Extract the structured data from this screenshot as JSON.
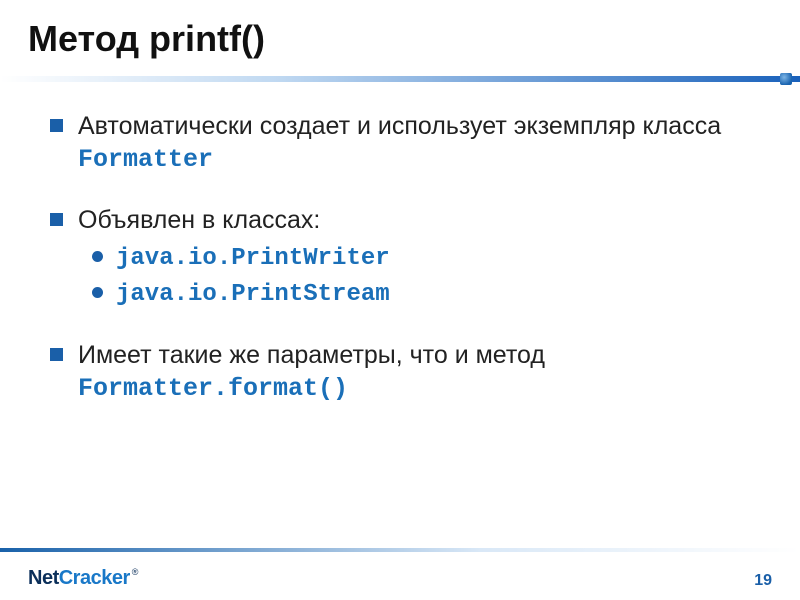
{
  "title": "Метод printf()",
  "bullets": [
    {
      "text_before": "Автоматически создает и использует экземпляр класса ",
      "code": "Formatter",
      "text_after": ""
    },
    {
      "text_before": "Объявлен в классах:",
      "code": "",
      "text_after": "",
      "children": [
        {
          "code": "java.io.PrintWriter"
        },
        {
          "code": "java.io.PrintStream"
        }
      ]
    },
    {
      "text_before": "Имеет такие же параметры, что и метод ",
      "code": "Formatter.format()",
      "text_after": ""
    }
  ],
  "logo": {
    "part1": "Net",
    "part2": "Cracker",
    "reg": "®"
  },
  "page_number": "19"
}
